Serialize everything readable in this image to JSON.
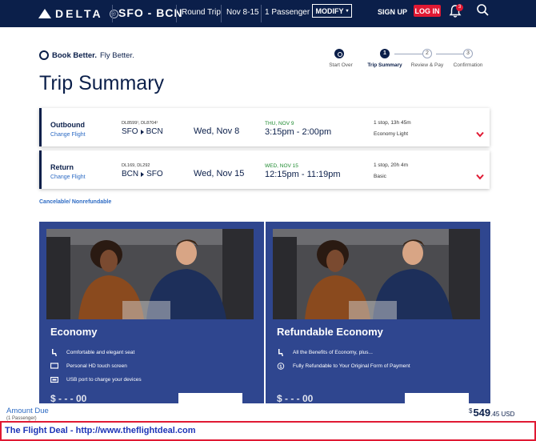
{
  "header": {
    "logo_text": "DELTA",
    "route": "SFO - BCN",
    "trip_type": "Round Trip",
    "dates": "Nov 8-15",
    "passengers": "1 Passenger",
    "modify_label": "MODIFY",
    "signup_label": "SIGN UP",
    "login_label": "LOG IN",
    "notification_count": "3"
  },
  "tagline": {
    "bold": "Book Better.",
    "rest": "Fly Better."
  },
  "page_title": "Trip Summary",
  "stepper": [
    {
      "number": "",
      "label": "Start Over",
      "state": "done"
    },
    {
      "number": "1",
      "label": "Trip Summary",
      "state": "active"
    },
    {
      "number": "2",
      "label": "Review & Pay",
      "state": "todo"
    },
    {
      "number": "3",
      "label": "Confirmation",
      "state": "todo"
    }
  ],
  "flights": [
    {
      "direction": "Outbound",
      "change_label": "Change Flight",
      "codes": "DL8599¹, DL8704¹",
      "origin": "SFO",
      "destination": "BCN",
      "date": "Wed, Nov 8",
      "arrival_day": "THU, NOV 9",
      "times": "3:15pm - 2:00pm",
      "stops": "1 stop, 13h 45m",
      "cabin": "Economy Light"
    },
    {
      "direction": "Return",
      "change_label": "Change Flight",
      "codes": "DL169, DL292",
      "origin": "BCN",
      "destination": "SFO",
      "date": "Wed, Nov 15",
      "arrival_day": "WED, NOV 15",
      "times": "12:15pm - 11:19pm",
      "stops": "1 stop, 20h 4m",
      "cabin": "Basic"
    }
  ],
  "cancel_policy": "Cancelable/ Nonrefundable",
  "fares": [
    {
      "name": "Economy",
      "features": [
        {
          "icon": "seat-icon",
          "text": "Comfortable and elegant seat"
        },
        {
          "icon": "screen-icon",
          "text": "Personal HD touch screen"
        },
        {
          "icon": "usb-icon",
          "text": "USB port to charge your devices"
        }
      ],
      "price_partial": "$ - - - 00"
    },
    {
      "name": "Refundable Economy",
      "features": [
        {
          "icon": "seat-icon",
          "text": "All the Benefits of Economy, plus..."
        },
        {
          "icon": "refund-dollar-icon",
          "text": "Fully Refundable to Your Original Form of Payment"
        }
      ],
      "price_partial": "$ - - - 00"
    }
  ],
  "amount_due": {
    "label": "Amount Due",
    "sublabel": "(1 Passenger)",
    "currency_symbol": "$",
    "whole": "549",
    "cents": ".45 USD"
  },
  "banner_text": "The Flight Deal - http://www.theflightdeal.com",
  "colors": {
    "navy": "#0b1f4a",
    "red": "#e01933",
    "fare_blue": "#2f468f",
    "link_blue": "#2d6bc4",
    "green": "#1d8a2f",
    "banner_blue": "#1d35b8"
  }
}
